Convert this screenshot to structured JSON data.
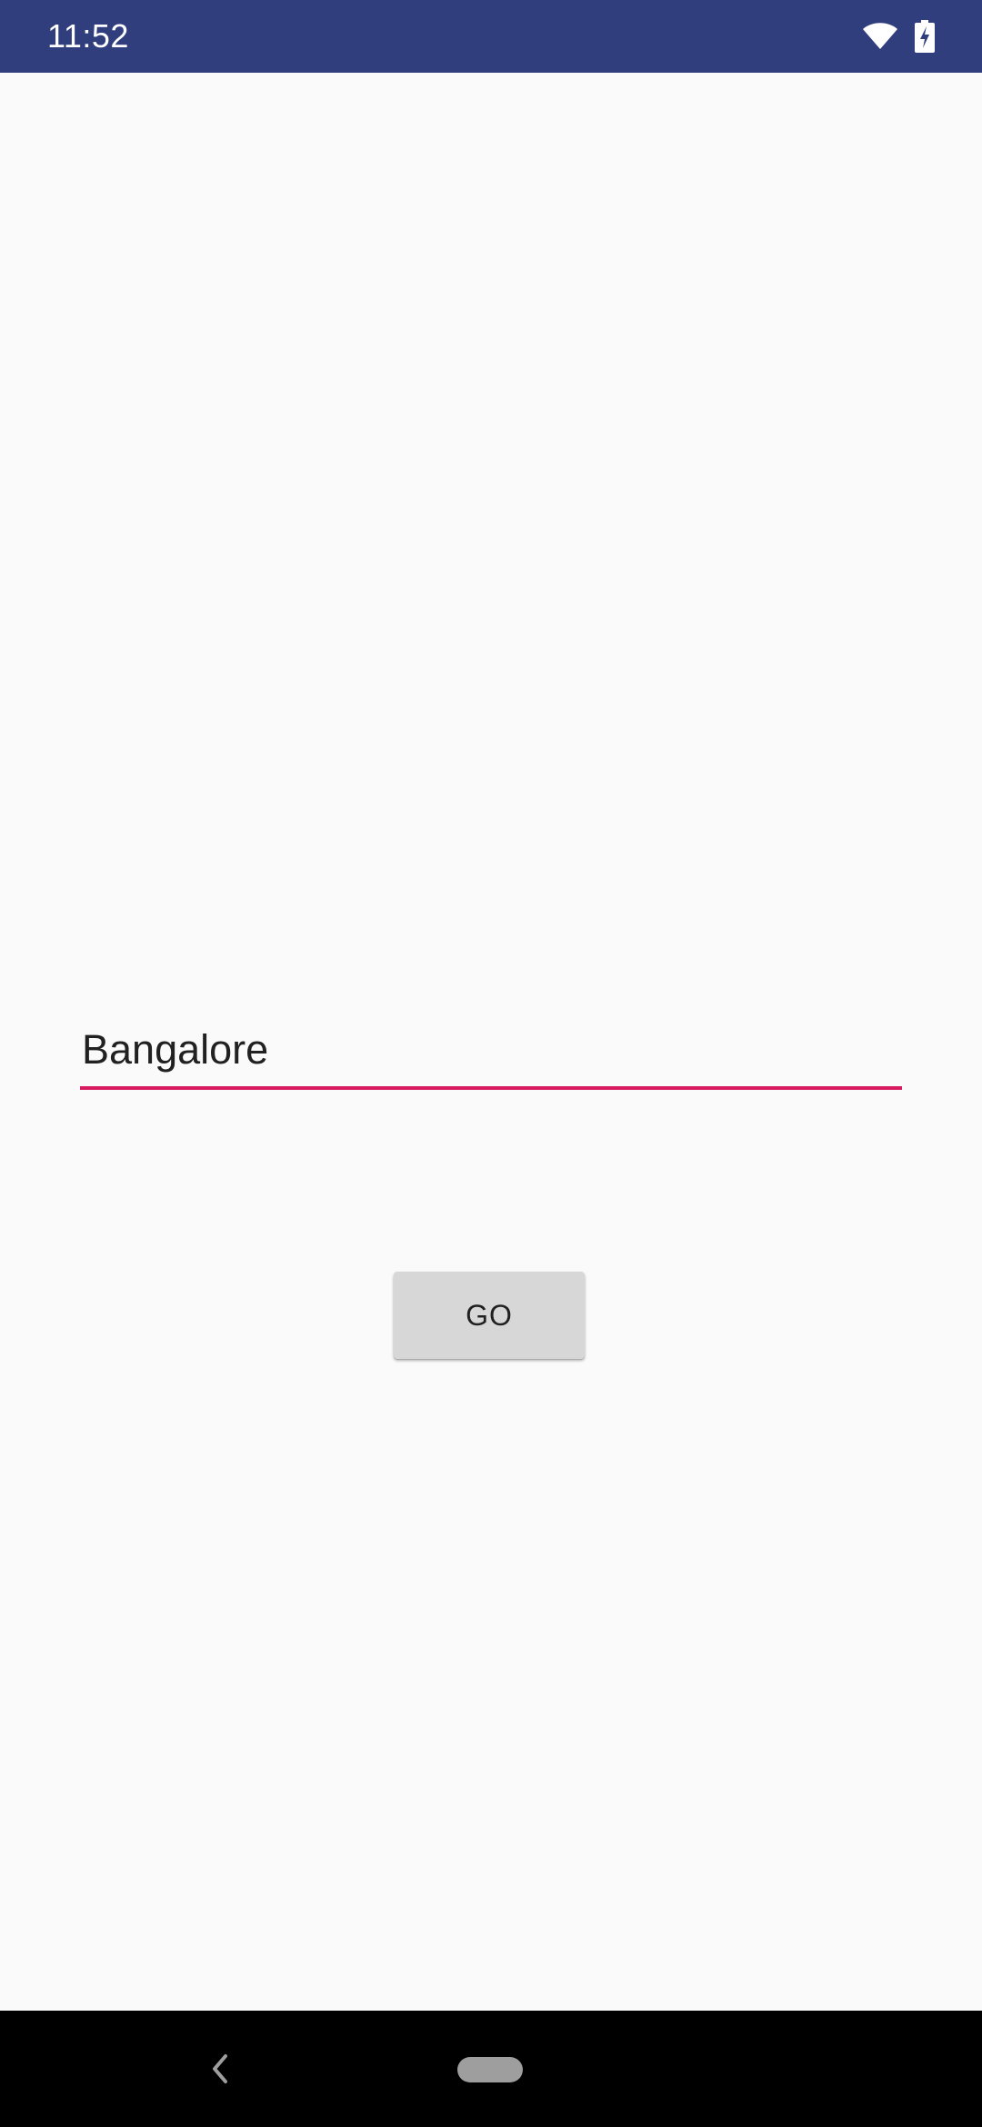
{
  "status_bar": {
    "time": "11:52",
    "background_color": "#303e7d",
    "icons": [
      "wifi-icon",
      "battery-charging-icon"
    ]
  },
  "form": {
    "city_value": "Bangalore",
    "underline_color": "#d81b60"
  },
  "actions": {
    "go_label": "GO"
  },
  "nav_bar": {
    "icons": [
      "back-icon",
      "home-pill-icon"
    ]
  }
}
